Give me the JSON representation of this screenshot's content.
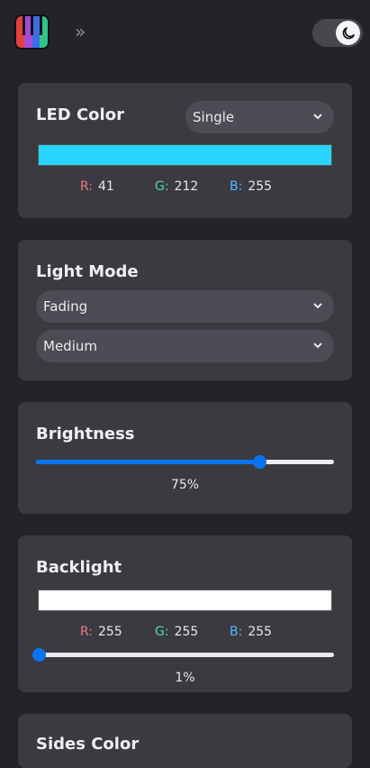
{
  "header": {
    "logo_icon": "piano-keys-rainbow-icon",
    "expand_icon": "double-chevron-right-icon",
    "expand_glyph": "»",
    "theme_icon": "moon-icon"
  },
  "led_color": {
    "title": "LED Color",
    "mode_select": "Single",
    "swatch_color": "#29d4ff",
    "r_label": "R:",
    "r_value": "41",
    "g_label": "G:",
    "g_value": "212",
    "b_label": "B:",
    "b_value": "255"
  },
  "light_mode": {
    "title": "Light Mode",
    "mode_select": "Fading",
    "speed_select": "Medium"
  },
  "brightness": {
    "title": "Brightness",
    "percent": 75,
    "percent_label": "75%"
  },
  "backlight": {
    "title": "Backlight",
    "swatch_color": "#ffffff",
    "r_label": "R:",
    "r_value": "255",
    "g_label": "G:",
    "g_value": "255",
    "b_label": "B:",
    "b_value": "255",
    "percent": 1,
    "percent_label": "1%"
  },
  "sides_color": {
    "title": "Sides Color"
  },
  "colors": {
    "background": "#242428",
    "card": "#3a3a40",
    "accent": "#0a73f0",
    "red_label": "#f07a85",
    "green_label": "#4fd8a8",
    "blue_label": "#4fb8ff"
  }
}
